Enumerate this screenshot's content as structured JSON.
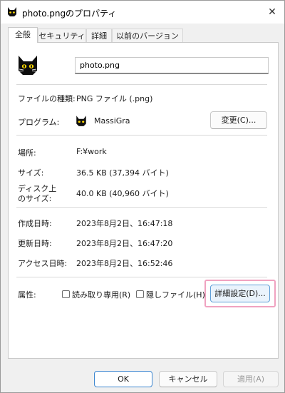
{
  "window": {
    "title": "photo.pngのプロパティ",
    "close_glyph": "✕"
  },
  "tabs": [
    {
      "label": "全般",
      "active": true
    },
    {
      "label": "セキュリティ",
      "active": false
    },
    {
      "label": "詳細",
      "active": false
    },
    {
      "label": "以前のバージョン",
      "active": false
    }
  ],
  "general": {
    "file_name": "photo.png",
    "file_type_label": "ファイルの種類:",
    "file_type_value": "PNG ファイル (.png)",
    "program_label": "プログラム:",
    "program_value": "MassiGra",
    "change_button": "変更(C)...",
    "location_label": "場所:",
    "location_value": "F:¥work",
    "size_label": "サイズ:",
    "size_value": "36.5 KB (37,394 バイト)",
    "disk_size_label_line1": "ディスク上",
    "disk_size_label_line2": "のサイズ:",
    "disk_size_value": "40.0 KB (40,960 バイト)",
    "created_label": "作成日時:",
    "created_value": "2023年8月2日、16:47:18",
    "modified_label": "更新日時:",
    "modified_value": "2023年8月2日、16:47:20",
    "accessed_label": "アクセス日時:",
    "accessed_value": "2023年8月2日、16:52:46",
    "attributes_label": "属性:",
    "readonly_label": "読み取り専用(R)",
    "readonly_checked": false,
    "hidden_label": "隠しファイル(H)",
    "hidden_checked": false,
    "advanced_button": "詳細設定(D)..."
  },
  "footer": {
    "ok": "OK",
    "cancel": "キャンセル",
    "apply": "適用(A)"
  },
  "colors": {
    "highlight": "#f0a2c0",
    "accent": "#3c86d0"
  },
  "icons": {
    "file_icon": "black-cat-icon",
    "program_icon": "black-cat-icon"
  }
}
